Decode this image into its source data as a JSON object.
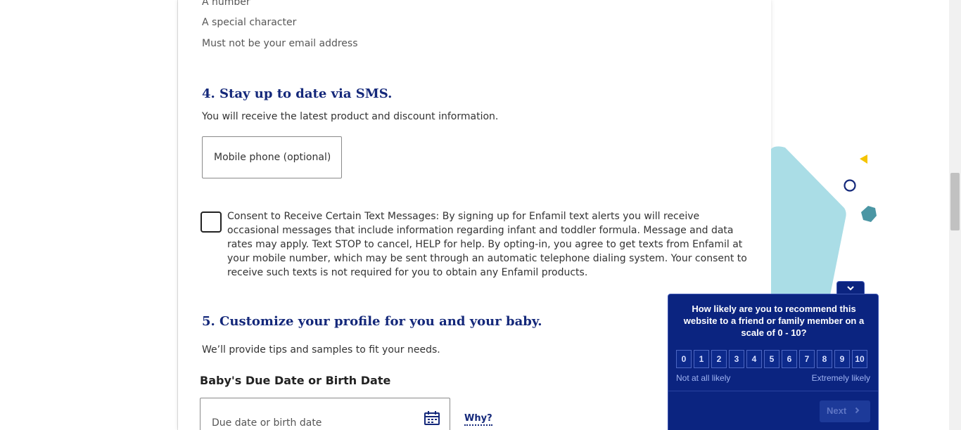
{
  "password_requirements": [
    "A number",
    "A special character",
    "Must not be your email address"
  ],
  "sms_section": {
    "heading": "4. Stay up to date via SMS.",
    "description": "You will receive the latest product and discount information.",
    "phone_placeholder": "Mobile phone (optional)",
    "consent_text": "Consent to Receive Certain Text Messages: By signing up for Enfamil text alerts you will receive occasional messages that include information regarding infant and toddler formula. Message and data rates may apply. Text STOP to cancel, HELP for help. By opting-in, you agree to get texts from Enfamil at your mobile number, which may be sent through an automatic telephone dialing system. Your consent to receive such texts is not required for you to obtain any Enfamil products."
  },
  "profile_section": {
    "heading": "5. Customize your profile for you and your baby.",
    "description": "We’ll provide tips and samples to fit your needs.",
    "date_label": "Baby's Due Date or Birth Date",
    "date_placeholder": "Due date or birth date",
    "why_link": "Why?"
  },
  "survey": {
    "question": "How likely are you to recommend this website to a friend or family member on a scale of 0 - 10?",
    "scale": [
      "0",
      "1",
      "2",
      "3",
      "4",
      "5",
      "6",
      "7",
      "8",
      "9",
      "10"
    ],
    "low_label": "Not at all likely",
    "high_label": "Extremely likely",
    "next_label": "Next",
    "toggle_icon": "chevron-down-icon"
  },
  "colors": {
    "heading": "#14287a",
    "survey_bg": "#0b2480",
    "deco_teal": "#aadde6",
    "deco_yellow": "#f5c400",
    "deco_hexagon": "#4b96a4"
  }
}
